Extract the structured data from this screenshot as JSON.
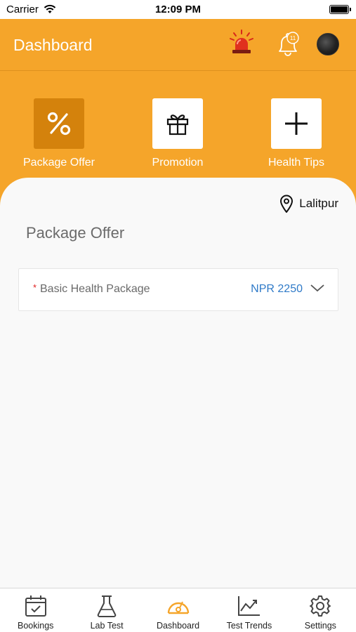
{
  "status_bar": {
    "carrier": "Carrier",
    "time": "12:09 PM"
  },
  "header": {
    "title": "Dashboard",
    "notification_count": "11",
    "background_color": "#f5a52a",
    "icons": [
      "alarm-siren-icon",
      "bell-icon",
      "avatar"
    ]
  },
  "quick_actions": [
    {
      "label": "Package Offer",
      "icon": "percent-icon",
      "active": true
    },
    {
      "label": "Promotion",
      "icon": "gift-icon",
      "active": false
    },
    {
      "label": "Health Tips",
      "icon": "plus-icon",
      "active": false
    }
  ],
  "content": {
    "location": "Lalitpur",
    "section_title": "Package Offer",
    "package": {
      "required_mark": "*",
      "name": "Basic Health Package",
      "price": "NPR 2250"
    }
  },
  "tabbar": {
    "items": [
      {
        "label": "Bookings",
        "icon": "calendar-check-icon"
      },
      {
        "label": "Lab Test",
        "icon": "flask-icon"
      },
      {
        "label": "Dashboard",
        "icon": "speedometer-icon",
        "active": true
      },
      {
        "label": "Test Trends",
        "icon": "chart-trend-icon"
      },
      {
        "label": "Settings",
        "icon": "gear-icon"
      }
    ],
    "active_color": "#f5a52a"
  }
}
